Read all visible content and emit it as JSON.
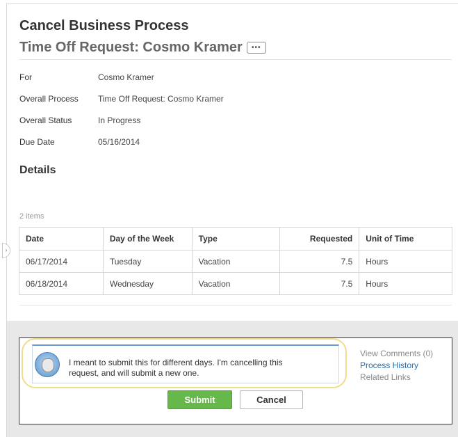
{
  "header": {
    "title": "Cancel Business Process",
    "subtitle": "Time Off Request: Cosmo Kramer",
    "more_icon": "•••"
  },
  "fields": [
    {
      "label": "For",
      "value": "Cosmo Kramer"
    },
    {
      "label": "Overall Process",
      "value": "Time Off Request: Cosmo Kramer"
    },
    {
      "label": "Overall Status",
      "value": "In Progress"
    },
    {
      "label": "Due Date",
      "value": "05/16/2014"
    }
  ],
  "details": {
    "title": "Details",
    "count": "2 items",
    "columns": [
      "Date",
      "Day of the Week",
      "Type",
      "Requested",
      "Unit of Time"
    ],
    "rows": [
      [
        "06/17/2014",
        "Tuesday",
        "Vacation",
        "7.5",
        "Hours"
      ],
      [
        "06/18/2014",
        "Wednesday",
        "Vacation",
        "7.5",
        "Hours"
      ]
    ]
  },
  "comment": {
    "text": "I meant to submit this for different days. I'm cancelling this\nrequest, and will submit a new one."
  },
  "links": {
    "view_comments": "View Comments (0)",
    "process_history": "Process History",
    "related_links": "Related Links"
  },
  "actions": {
    "submit": "Submit",
    "cancel": "Cancel"
  },
  "side_handle_icon": "›"
}
